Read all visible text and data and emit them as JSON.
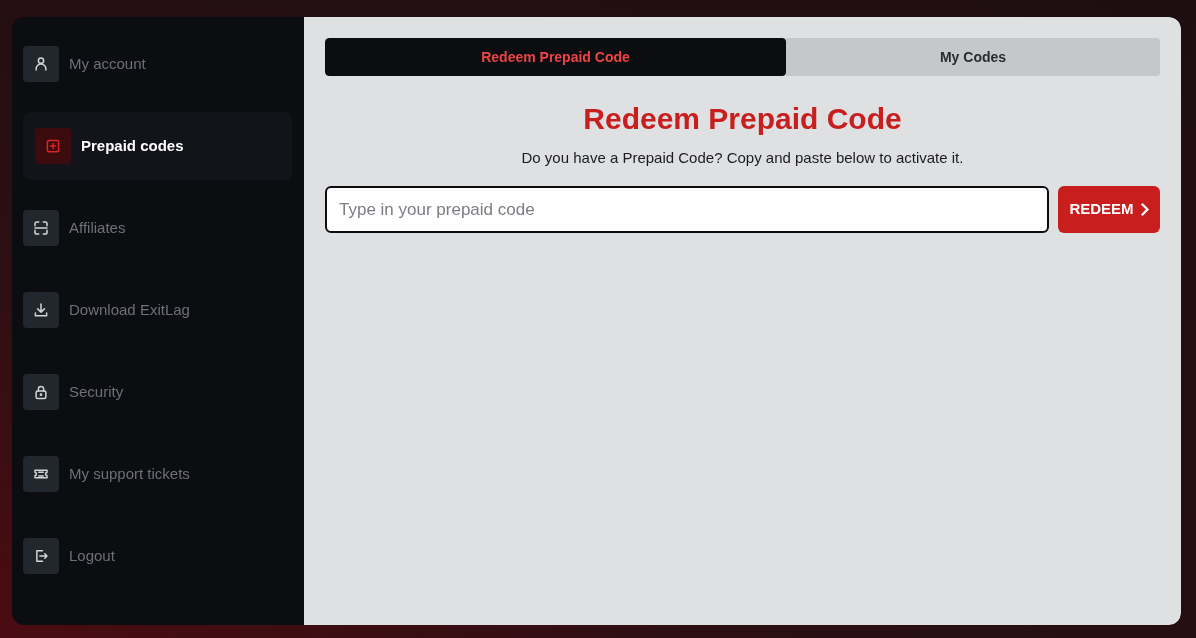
{
  "sidebar": {
    "items": [
      {
        "label": "My account",
        "selected": false
      },
      {
        "label": "Prepaid codes",
        "selected": true
      },
      {
        "label": "Affiliates",
        "selected": false
      },
      {
        "label": "Download ExitLag",
        "selected": false
      },
      {
        "label": "Security",
        "selected": false
      },
      {
        "label": "My support tickets",
        "selected": false
      },
      {
        "label": "Logout",
        "selected": false
      }
    ]
  },
  "tabs": [
    {
      "label": "Redeem Prepaid Code",
      "selected": true
    },
    {
      "label": "My Codes",
      "selected": false
    }
  ],
  "heading": "Redeem Prepaid Code",
  "description": "Do you have a Prepaid Code? Copy and paste below to activate it.",
  "code_field": {
    "placeholder": "Type in your prepaid code"
  },
  "redeem_button": {
    "label": "REDEEM"
  }
}
